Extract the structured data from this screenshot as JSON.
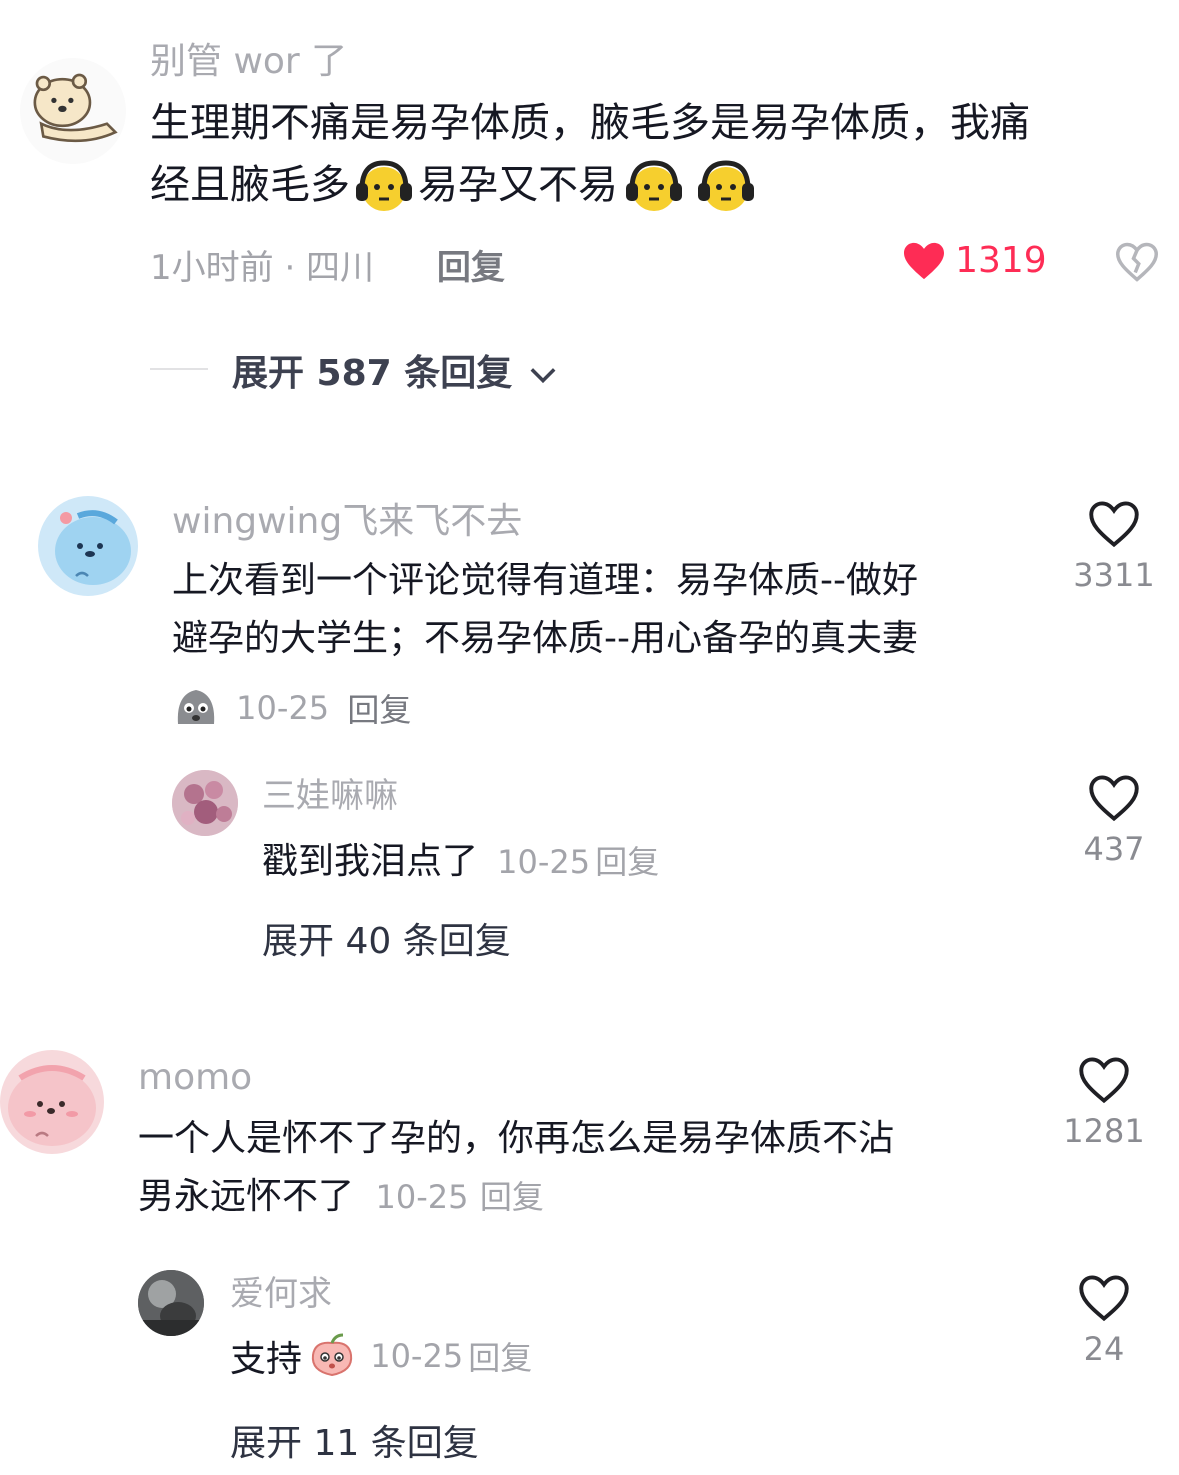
{
  "comment1": {
    "username": "别管 wor 了",
    "text_a": "生理期不痛是易孕体质，腋毛多是易孕体质，我痛",
    "text_b": "经且腋毛多",
    "text_c": "易孕又不易",
    "emoji": "headphone-face-emoji",
    "time_location": "1小时前 · 四川",
    "reply_label": "回复",
    "like_count": "1319",
    "like_color": "#fe2c55",
    "expand_label": "展开 587 条回复"
  },
  "comment2": {
    "username": "wingwing飞来飞不去",
    "text_a": "上次看到一个评论觉得有道理：易孕体质--做好",
    "text_b": "避孕的大学生；不易孕体质--用心备孕的真夫妻",
    "emoji": "gray-face-emoji",
    "date": "10-25",
    "reply_label": "回复",
    "like_count": "3311",
    "sub": {
      "username": "三娃嘛嘛",
      "text": "戳到我泪点了",
      "date": "10-25",
      "reply_label": "回复",
      "like_count": "437"
    },
    "expand_label": "展开 40 条回复"
  },
  "comment3": {
    "username": "momo",
    "text_a": "一个人是怀不了孕的，你再怎么是易孕体质不沾",
    "text_b": "男永远怀不了",
    "date": "10-25",
    "reply_label": "回复",
    "like_count": "1281",
    "sub": {
      "username": "爱何求",
      "text": "支持",
      "emoji": "peach-face-emoji",
      "date": "10-25",
      "reply_label": "回复",
      "like_count": "24"
    },
    "expand_label": "展开 11 条回复"
  }
}
